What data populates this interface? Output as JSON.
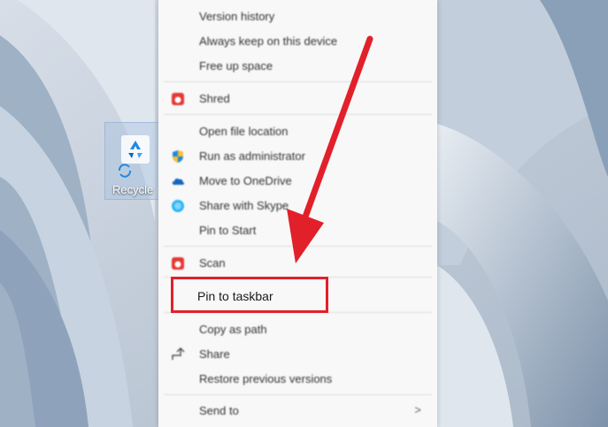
{
  "desktop": {
    "recycle_bin_label": "Recycle"
  },
  "menu": {
    "section1": [
      "Version history",
      "Always keep on this device",
      "Free up space"
    ],
    "shred": "Shred",
    "section2": {
      "open_location": "Open file location",
      "run_admin": "Run as administrator",
      "onedrive": "Move to OneDrive",
      "skype": "Share with Skype",
      "pin_start": "Pin to Start"
    },
    "scan": "Scan",
    "pin_taskbar": "Pin to taskbar",
    "section4": {
      "copy_path": "Copy as path",
      "share": "Share",
      "restore": "Restore previous versions"
    },
    "send_to": "Send to",
    "send_to_chevron": ">"
  },
  "annotation": {
    "highlight_color": "#e2202a",
    "arrow_color": "#e2202a"
  }
}
